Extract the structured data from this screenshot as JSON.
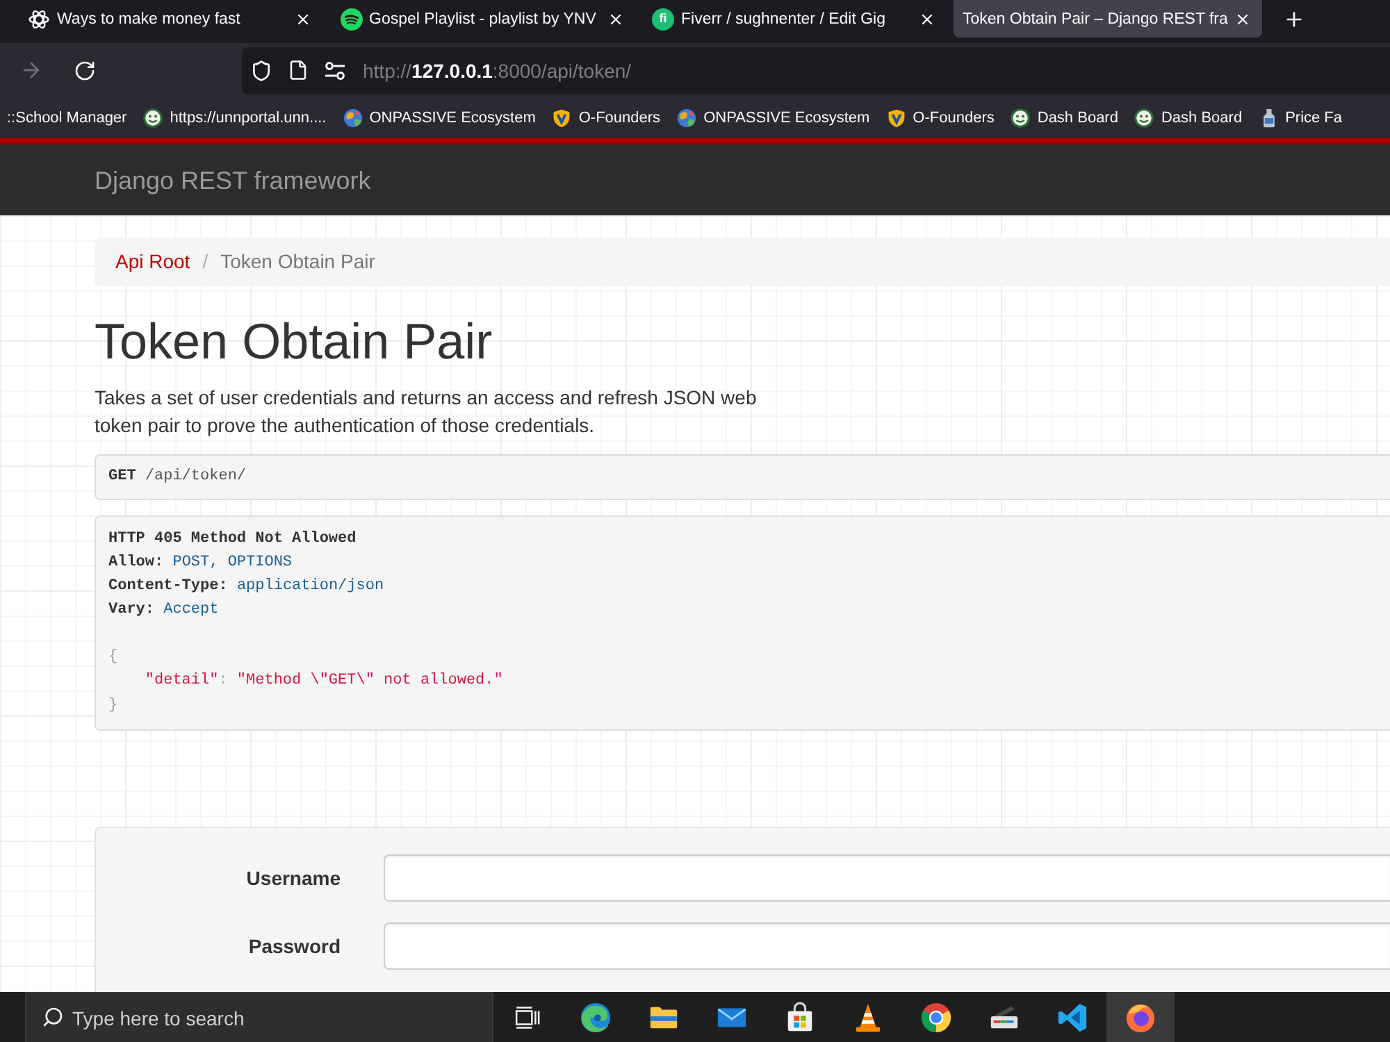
{
  "browser": {
    "tabs": [
      {
        "title": "Ways to make money fast",
        "kind": "knot",
        "selected": false
      },
      {
        "title": "Gospel Playlist - playlist by YNV",
        "kind": "waves",
        "selected": false
      },
      {
        "title": "Fiverr / sughnenter / Edit Gig",
        "kind": "letters",
        "icon_text": "fi",
        "selected": false
      },
      {
        "title": "Token Obtain Pair – Django REST fra",
        "kind": "plain",
        "selected": true
      }
    ],
    "nav_buttons": [
      {
        "kind": "forward",
        "disabled": true
      },
      {
        "kind": "reload",
        "disabled": false
      }
    ],
    "address": {
      "parts": [
        {
          "text": "http://",
          "emphasized": false
        },
        {
          "text": "127.0.0.1",
          "emphasized": true
        },
        {
          "text": ":8000/api/token/",
          "emphasized": false
        }
      ]
    },
    "bookmarks": [
      {
        "label": "::School Manager",
        "kind": "plain"
      },
      {
        "label": "https://unnportal.unn....",
        "kind": "face"
      },
      {
        "label": "ONPASSIVE Ecosystem",
        "kind": "globe"
      },
      {
        "label": "O-Founders",
        "kind": "shield"
      },
      {
        "label": "ONPASSIVE Ecosystem",
        "kind": "globe"
      },
      {
        "label": "O-Founders",
        "kind": "shield"
      },
      {
        "label": "Dash Board",
        "kind": "face"
      },
      {
        "label": "Dash Board",
        "kind": "face"
      },
      {
        "label": "Price Fa",
        "kind": "bottle"
      }
    ]
  },
  "page": {
    "brand": "Django REST framework",
    "breadcrumb": {
      "separator": "/",
      "items": [
        {
          "label": "Api Root",
          "active": false
        },
        {
          "label": "Token Obtain Pair",
          "active": true
        }
      ]
    },
    "title": "Token Obtain Pair",
    "description": "Takes a set of user credentials and returns an access and refresh JSON web token pair to prove the authentication of those credentials.",
    "request": {
      "method": "GET",
      "path": "/api/token/"
    },
    "response": {
      "status": "HTTP 405 Method Not Allowed",
      "headers": [
        {
          "name": "Allow:",
          "value": "POST, OPTIONS"
        },
        {
          "name": "Content-Type:",
          "value": "application/json"
        },
        {
          "name": "Vary:",
          "value": "Accept"
        }
      ],
      "body": {
        "open": "{",
        "entries": [
          {
            "key": "\"detail\"",
            "separator": ":",
            "value": "\"Method \\\"GET\\\" not allowed.\""
          }
        ],
        "close": "}"
      }
    },
    "form": {
      "fields": [
        {
          "label": "Username"
        },
        {
          "label": "Password"
        }
      ]
    }
  },
  "taskbar": {
    "search": {
      "placeholder": "Type here to search"
    },
    "apps": [
      {
        "kind": "taskview",
        "selected": false
      },
      {
        "kind": "swirl",
        "selected": false
      },
      {
        "kind": "folder",
        "selected": false
      },
      {
        "kind": "envelope",
        "selected": false
      },
      {
        "kind": "bag",
        "selected": false
      },
      {
        "kind": "cone",
        "selected": false
      },
      {
        "kind": "segments",
        "selected": false
      },
      {
        "kind": "scanner",
        "selected": false
      },
      {
        "kind": "ribbon",
        "selected": false
      },
      {
        "kind": "orb",
        "selected": true
      }
    ]
  }
}
